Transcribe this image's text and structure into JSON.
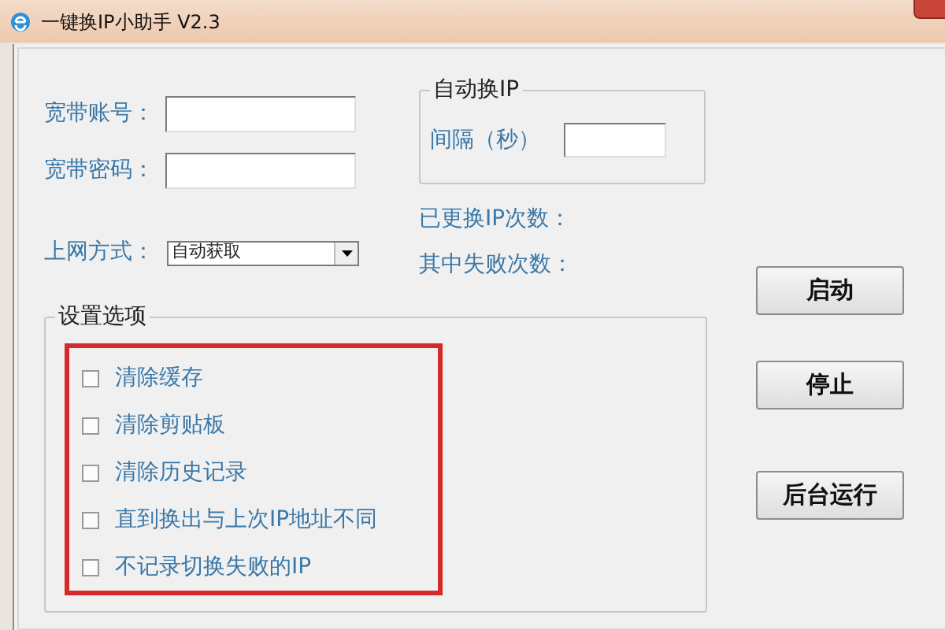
{
  "window": {
    "title": "一键换IP小助手 V2.3"
  },
  "account": {
    "label": "宽带账号："
  },
  "password": {
    "label": "宽带密码："
  },
  "connection": {
    "label": "上网方式：",
    "value": "自动获取"
  },
  "auto_switch": {
    "title": "自动换IP",
    "interval_label": "间隔（秒）"
  },
  "stats": [
    "已更换IP次数：",
    "其中失败次数："
  ],
  "settings": {
    "title": "设置选项",
    "options": [
      {
        "label": "清除缓存",
        "checked": false
      },
      {
        "label": "清除剪贴板",
        "checked": false
      },
      {
        "label": "清除历史记录",
        "checked": false
      },
      {
        "label": "直到换出与上次IP地址不同",
        "checked": false
      },
      {
        "label": "不记录切换失败的IP",
        "checked": false
      }
    ]
  },
  "buttons": [
    "启动",
    "停止",
    "后台运行"
  ]
}
